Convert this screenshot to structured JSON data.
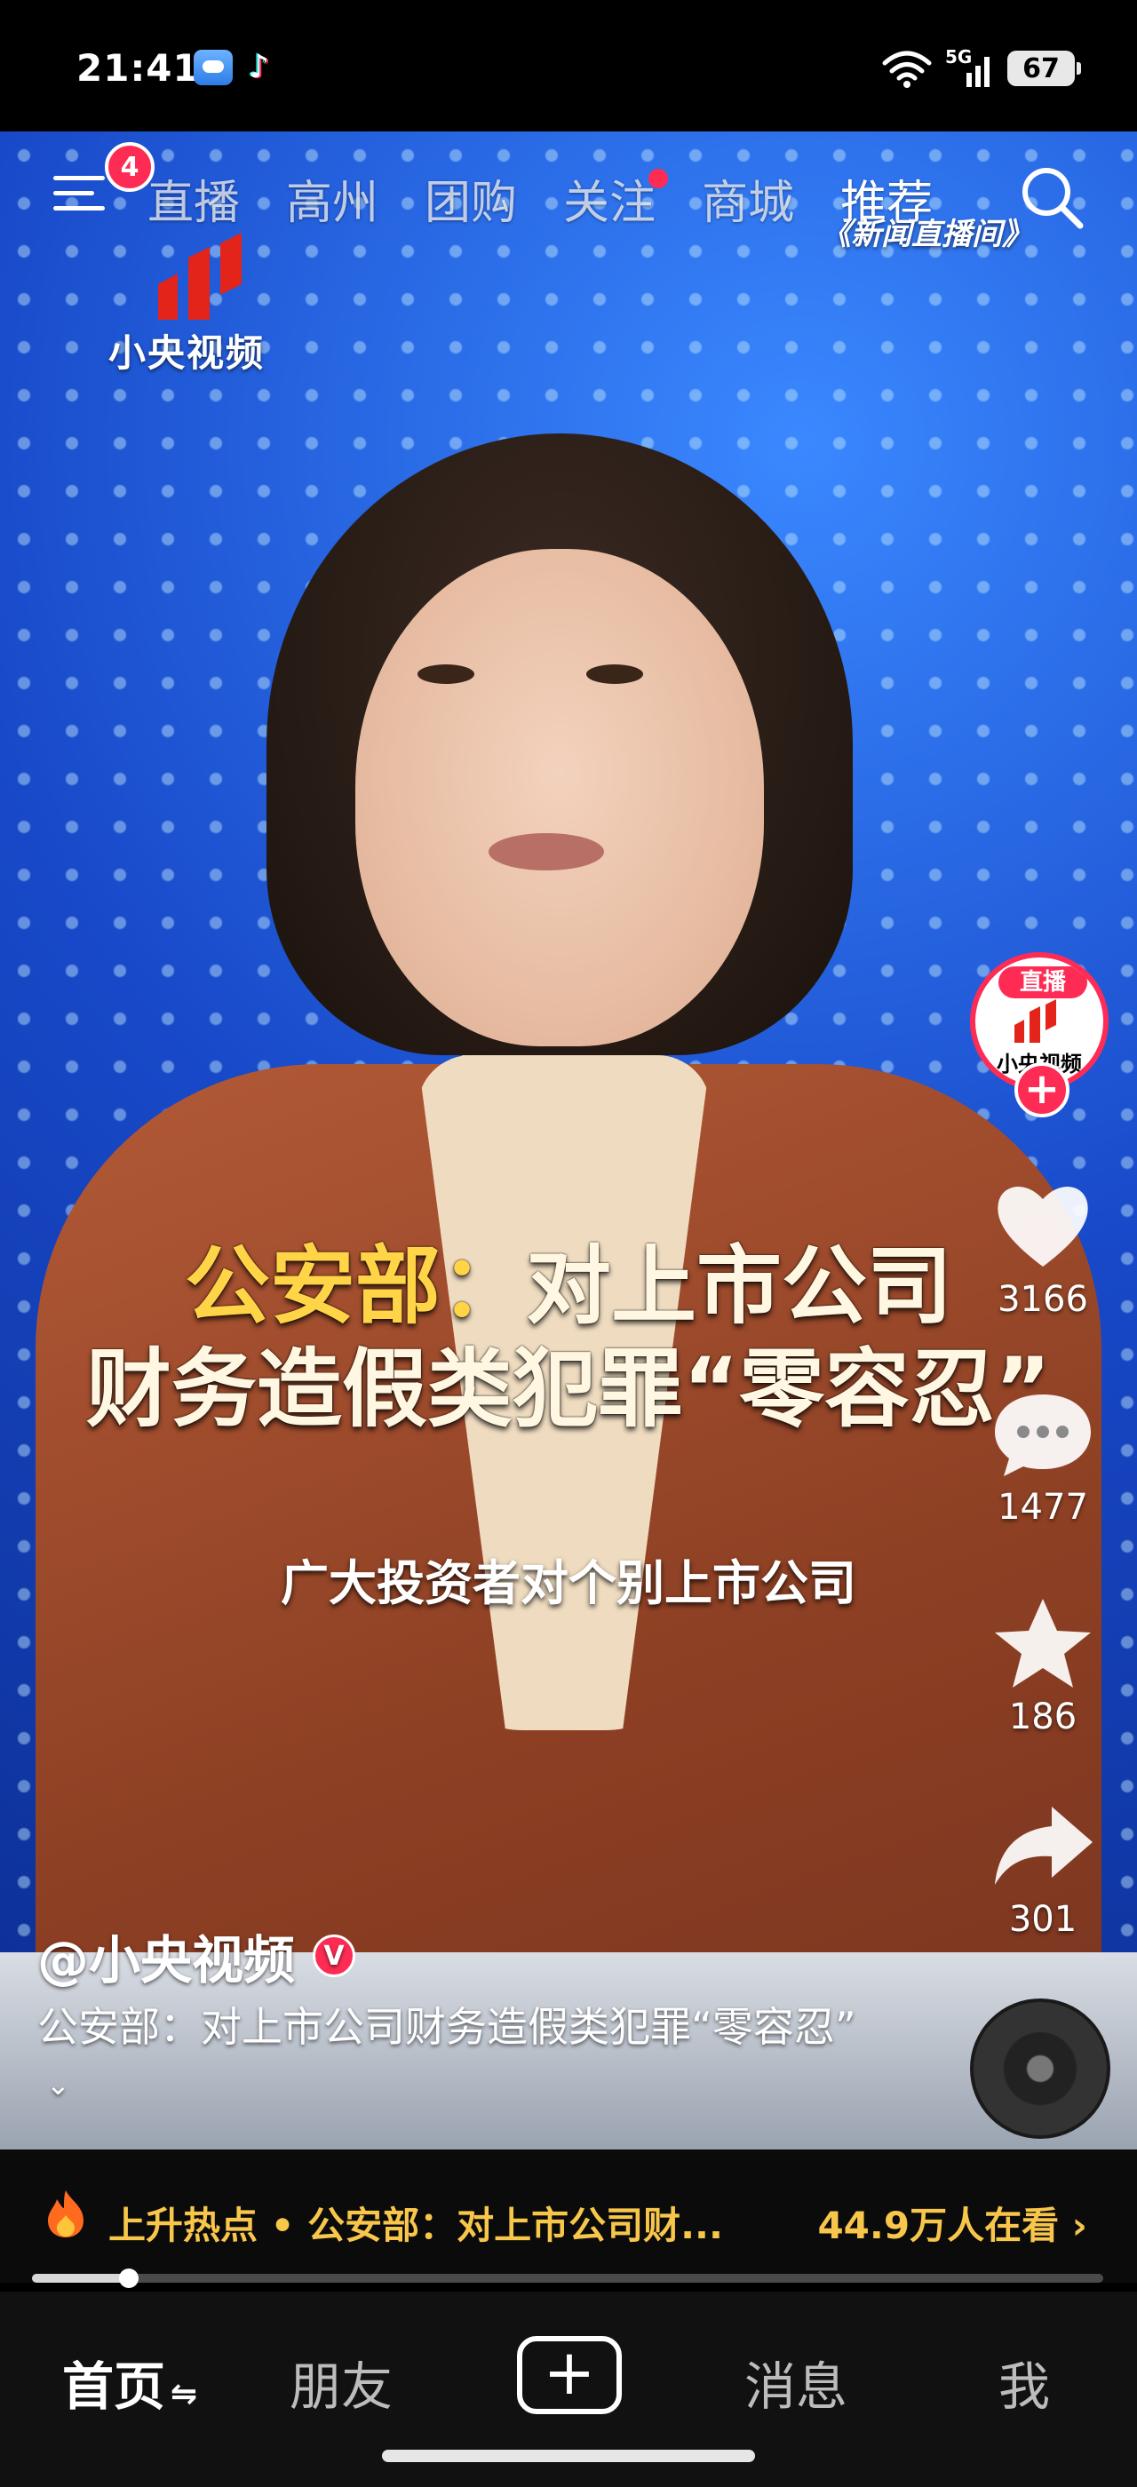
{
  "status_bar": {
    "time": "21:41",
    "network": "5G",
    "battery": "67",
    "icons": [
      "weather-app-icon",
      "tiktok-app-icon",
      "wifi-icon",
      "signal-icon",
      "battery-icon"
    ]
  },
  "top_nav": {
    "menu_badge": "4",
    "tabs": [
      {
        "label": "直播",
        "active": false,
        "dot": false
      },
      {
        "label": "高州",
        "active": false,
        "dot": false
      },
      {
        "label": "团购",
        "active": false,
        "dot": false
      },
      {
        "label": "关注",
        "active": false,
        "dot": true
      },
      {
        "label": "商城",
        "active": false,
        "dot": false
      },
      {
        "label": "推荐",
        "active": true,
        "dot": false
      }
    ],
    "program_caption": "《新闻直播间》"
  },
  "video": {
    "channel_logo_text": "小央视频",
    "headline_accent": "公安部：",
    "headline_line1_rest": "对上市公司",
    "headline_line2": "财务造假类犯罪“零容忍”",
    "subtitle": "广大投资者对个别上市公司"
  },
  "rail": {
    "avatar_live_label": "直播",
    "avatar_name": "小央视频",
    "like_count": "3166",
    "comment_count": "1477",
    "favorite_count": "186",
    "share_count": "301"
  },
  "author": {
    "handle": "@小央视频",
    "verified": "V"
  },
  "description": {
    "text": "公安部：对上市公司财务造假类犯罪“零容忍”",
    "expand_icon": "chevron-down-icon"
  },
  "hot_bar": {
    "label": "上升热点 • 公安部：对上市公司财...",
    "viewers": "44.9万人在看 ›",
    "progress": 0.09
  },
  "bottom_nav": {
    "home": "首页",
    "friends": "朋友",
    "plus": "+",
    "messages": "消息",
    "me": "我"
  },
  "colors": {
    "accent": "#fe2c55",
    "headline_highlight": "#ffd447",
    "hot_text": "#f7c64b"
  }
}
